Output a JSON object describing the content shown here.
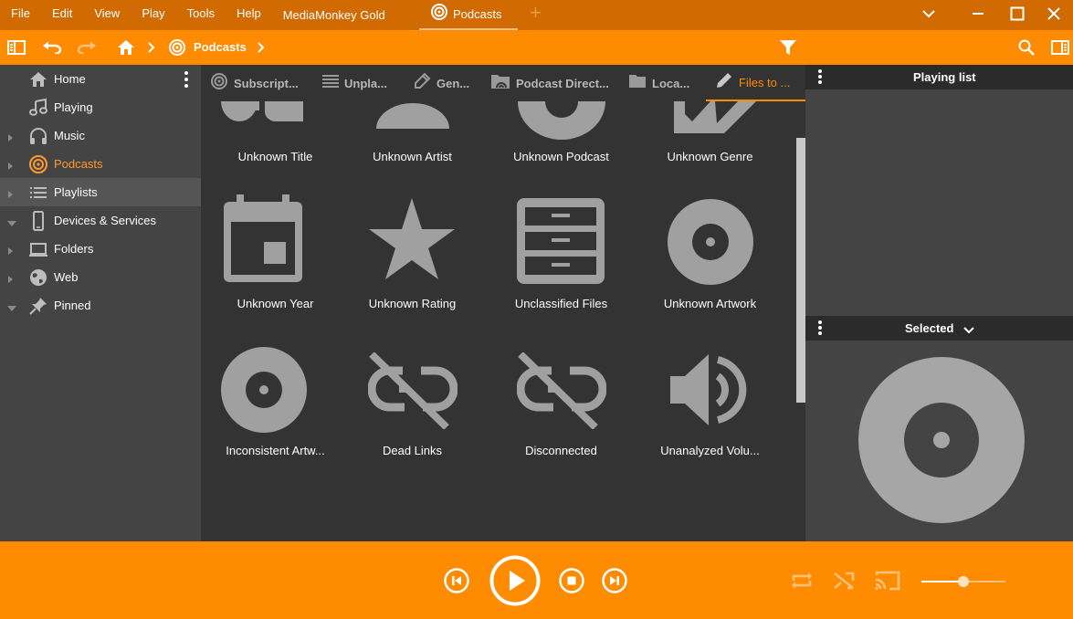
{
  "menu": {
    "items": [
      "File",
      "Edit",
      "View",
      "Play",
      "Tools",
      "Help"
    ],
    "app_title": "MediaMonkey Gold",
    "active_tab": "Podcasts"
  },
  "toolbar": {
    "breadcrumb_label": "Podcasts"
  },
  "sidebar": {
    "items": [
      {
        "label": "Home",
        "icon": "home-icon",
        "expandable": false
      },
      {
        "label": "Playing",
        "icon": "music-note-icon",
        "expandable": false
      },
      {
        "label": "Music",
        "icon": "headphones-icon",
        "expandable": true
      },
      {
        "label": "Podcasts",
        "icon": "podcast-icon",
        "expandable": true,
        "active": true
      },
      {
        "label": "Playlists",
        "icon": "playlist-icon",
        "expandable": true
      },
      {
        "label": "Devices & Services",
        "icon": "phone-icon",
        "expandable": true,
        "expanded": true
      },
      {
        "label": "Folders",
        "icon": "laptop-icon",
        "expandable": true
      },
      {
        "label": "Web",
        "icon": "globe-icon",
        "expandable": true
      },
      {
        "label": "Pinned",
        "icon": "pin-icon",
        "expandable": true,
        "expanded": true
      }
    ]
  },
  "content": {
    "tabs": [
      {
        "label": "Subscript...",
        "icon": "podcast-icon"
      },
      {
        "label": "Unpla...",
        "icon": "list-icon"
      },
      {
        "label": "Gen...",
        "icon": "genre-icon"
      },
      {
        "label": "Podcast Direct...",
        "icon": "podcast-folder-icon"
      },
      {
        "label": "Loca...",
        "icon": "folder-icon"
      },
      {
        "label": "Files to ...",
        "icon": "edit-icon",
        "active": true
      }
    ],
    "grid": [
      {
        "label": "Unknown Title",
        "icon": "music-note-icon"
      },
      {
        "label": "Unknown Artist",
        "icon": "artist-icon"
      },
      {
        "label": "Unknown Podcast",
        "icon": "podcast-icon"
      },
      {
        "label": "Unknown Genre",
        "icon": "genre-icon"
      },
      {
        "label": "Unknown Year",
        "icon": "calendar-icon"
      },
      {
        "label": "Unknown Rating",
        "icon": "star-icon"
      },
      {
        "label": "Unclassified Files",
        "icon": "cabinet-icon"
      },
      {
        "label": "Unknown Artwork",
        "icon": "disc-icon"
      },
      {
        "label": "Inconsistent Artw...",
        "icon": "disc-icon"
      },
      {
        "label": "Dead Links",
        "icon": "link-off-icon"
      },
      {
        "label": "Disconnected",
        "icon": "link-off-icon"
      },
      {
        "label": "Unanalyzed Volu...",
        "icon": "volume-icon"
      }
    ]
  },
  "right_panel": {
    "playing_list_title": "Playing list",
    "selected_title": "Selected"
  },
  "colors": {
    "accent": "#ff8c00",
    "titlebar": "#d16a00",
    "sidebar_bg": "#444444",
    "content_bg": "#333333",
    "icon_gray": "#a0a0a0"
  },
  "player": {
    "volume_level": 0.5
  }
}
